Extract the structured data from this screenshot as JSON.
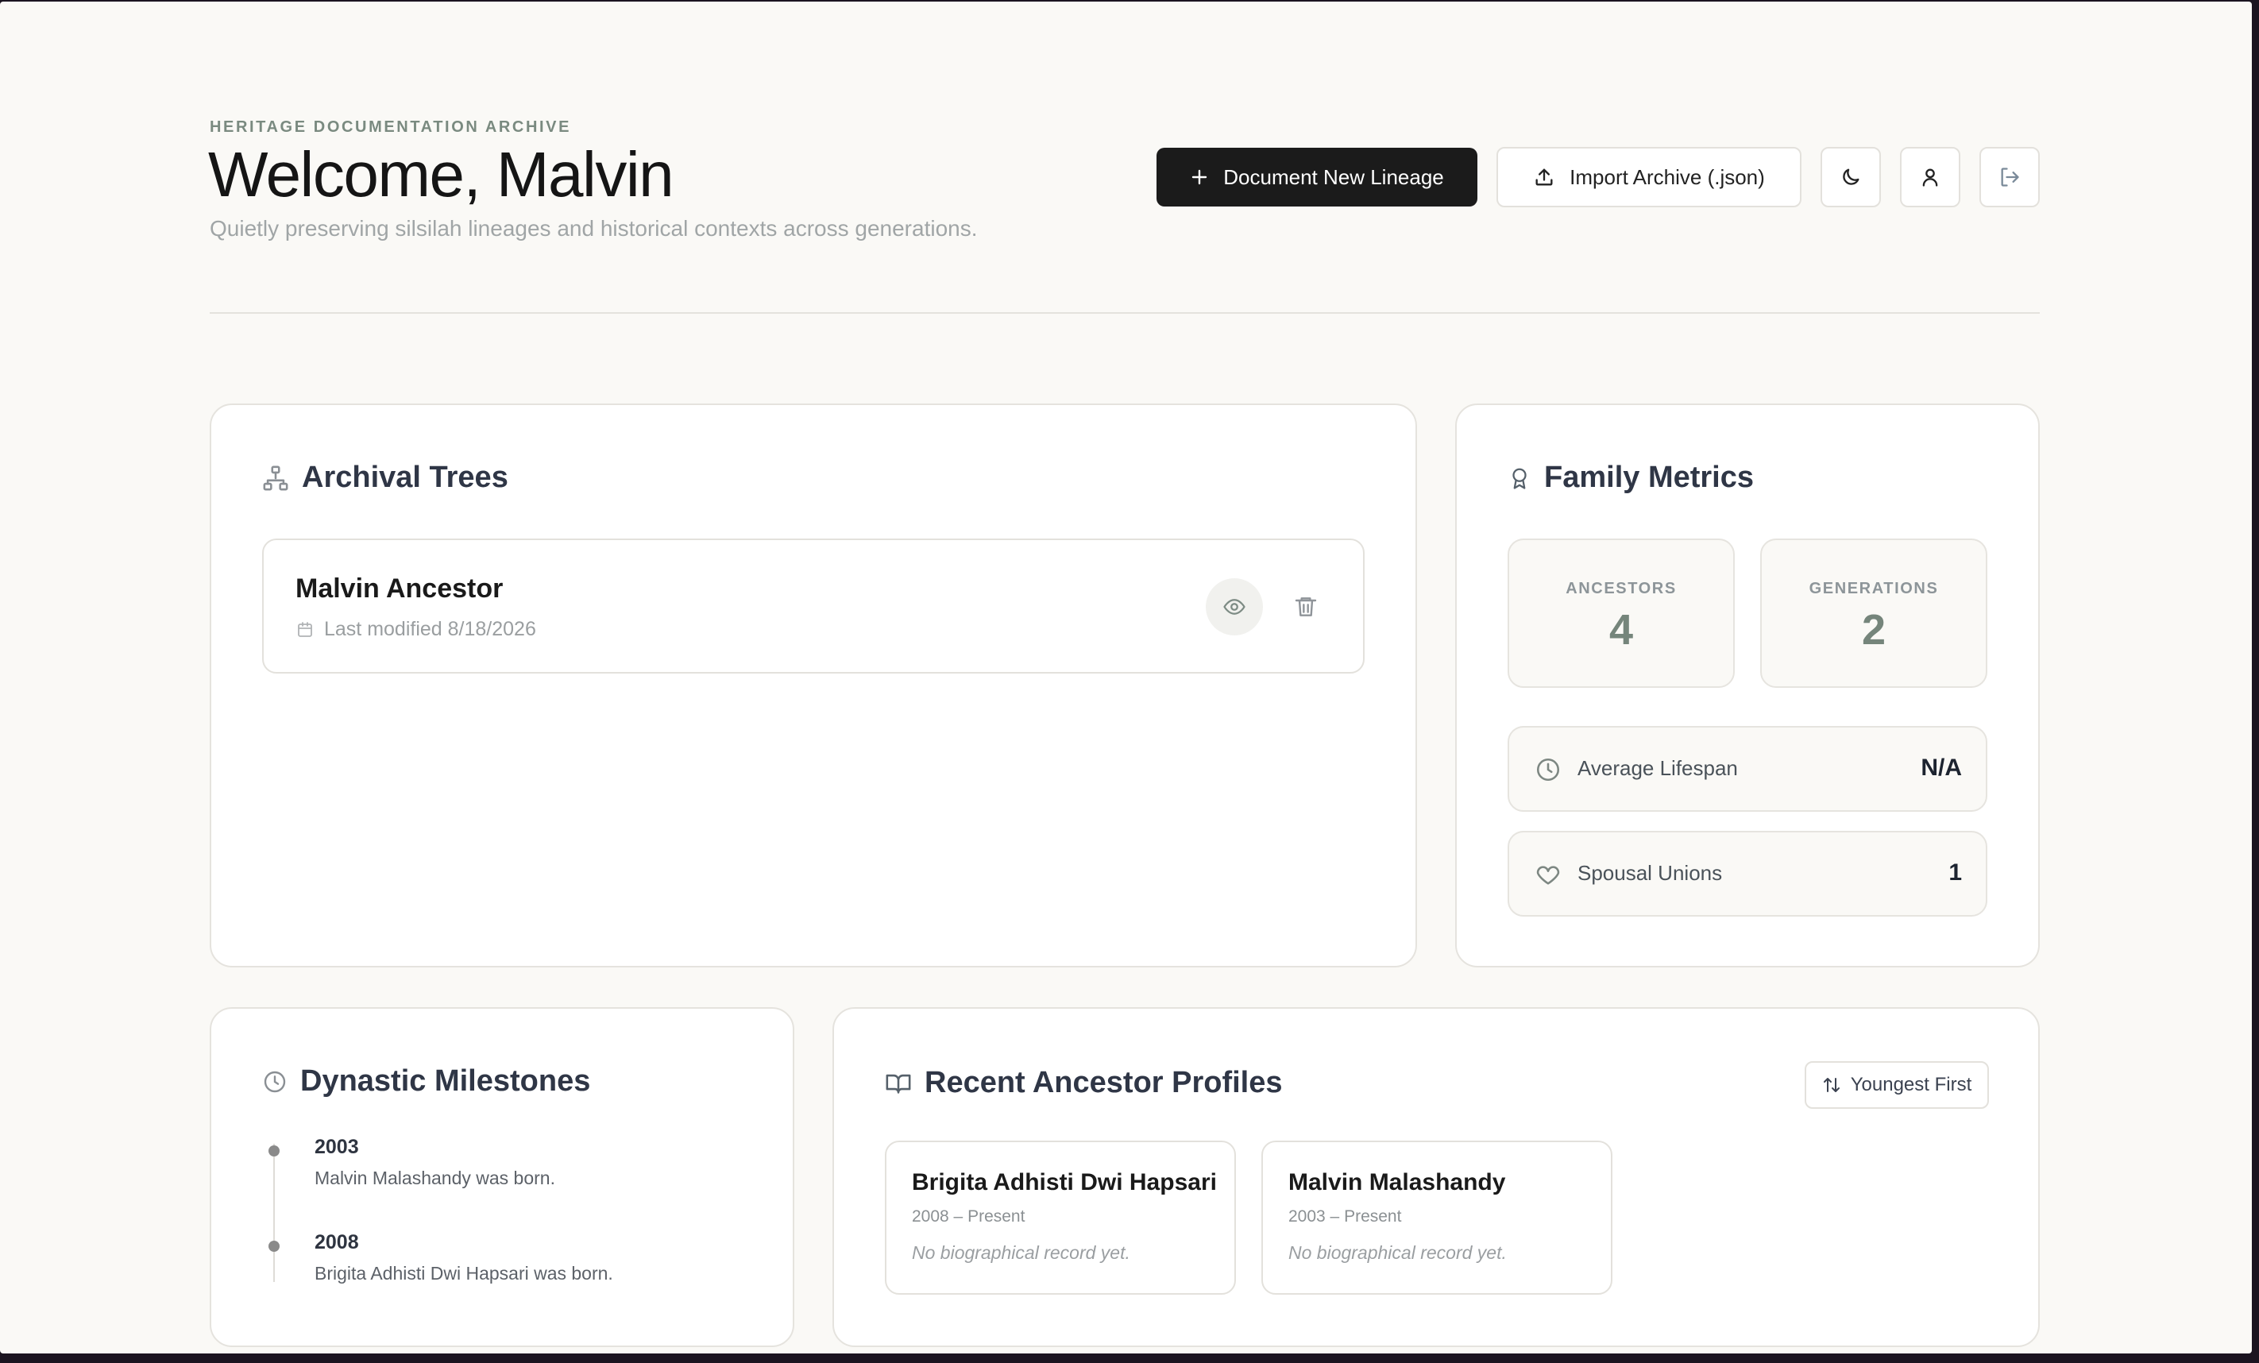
{
  "header": {
    "kicker": "HERITAGE DOCUMENTATION ARCHIVE",
    "welcome": "Welcome, Malvin",
    "subtitle": "Quietly preserving silsilah lineages and historical contexts across generations."
  },
  "toolbar": {
    "document_new_label": "Document New Lineage",
    "import_label": "Import Archive (.json)",
    "icons": [
      "plus-icon",
      "upload-icon",
      "moon-icon",
      "user-icon",
      "logout-icon"
    ]
  },
  "archival_trees": {
    "title": "Archival Trees",
    "items": [
      {
        "name": "Malvin Ancestor",
        "modified": "Last modified 8/18/2026"
      }
    ]
  },
  "family_metrics": {
    "title": "Family Metrics",
    "stats": [
      {
        "label": "ANCESTORS",
        "value": "4"
      },
      {
        "label": "GENERATIONS",
        "value": "2"
      }
    ],
    "rows": [
      {
        "label": "Average Lifespan",
        "value": "N/A",
        "icon": "clock-icon"
      },
      {
        "label": "Spousal Unions",
        "value": "1",
        "icon": "heart-icon"
      }
    ]
  },
  "milestones": {
    "title": "Dynastic Milestones",
    "events": [
      {
        "year": "2003",
        "text": "Malvin Malashandy was born."
      },
      {
        "year": "2008",
        "text": "Brigita Adhisti Dwi Hapsari was born."
      }
    ]
  },
  "profiles": {
    "title": "Recent Ancestor Profiles",
    "sort_label": "Youngest First",
    "items": [
      {
        "name": "Brigita Adhisti Dwi Hapsari",
        "years": "2008 – Present",
        "bio": "No biographical record yet."
      },
      {
        "name": "Malvin Malashandy",
        "years": "2003 – Present",
        "bio": "No biographical record yet."
      }
    ]
  },
  "colors": {
    "primary_button": "#1b1b1b",
    "background": "#faf9f6",
    "accent_sage": "#75857b"
  }
}
